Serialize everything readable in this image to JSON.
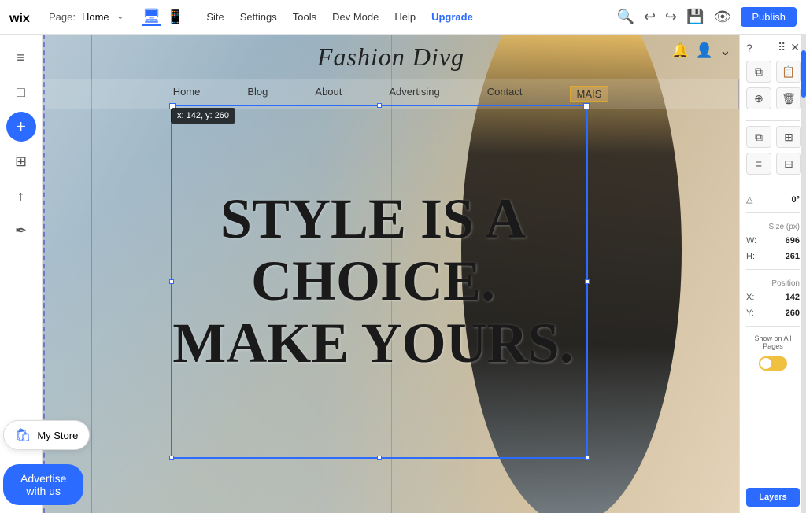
{
  "topbar": {
    "logo_text": "W",
    "page_label": "Page:",
    "page_name": "Home",
    "nav_items": [
      "Site",
      "Settings",
      "Tools",
      "Dev Mode",
      "Help",
      "Upgrade"
    ],
    "device_desktop": "🖥",
    "device_mobile": "📱"
  },
  "sidebar": {
    "icons": [
      "≡",
      "□",
      "+",
      "⊞",
      "↑",
      "✒"
    ]
  },
  "canvas": {
    "site_logo": "Fashion Divg",
    "nav_items": [
      "Home",
      "Blog",
      "About",
      "Advertising",
      "Contact",
      "MAIS"
    ],
    "hero_text": "STYLE IS A CHOICE. MAKE YOURS.",
    "position_tooltip": "x: 142, y: 260",
    "my_store_label": "My Store",
    "advertise_label": "Advertise with us"
  },
  "right_panel": {
    "size_label": "Size (px)",
    "width_label": "W:",
    "width_value": "696",
    "height_label": "H:",
    "height_value": "261",
    "position_label": "Position",
    "x_label": "X:",
    "x_value": "142",
    "y_label": "Y:",
    "y_value": "260",
    "show_all_pages_label": "Show on All Pages",
    "layers_label": "Layers",
    "angle_label": "0°",
    "question_mark": "?"
  }
}
